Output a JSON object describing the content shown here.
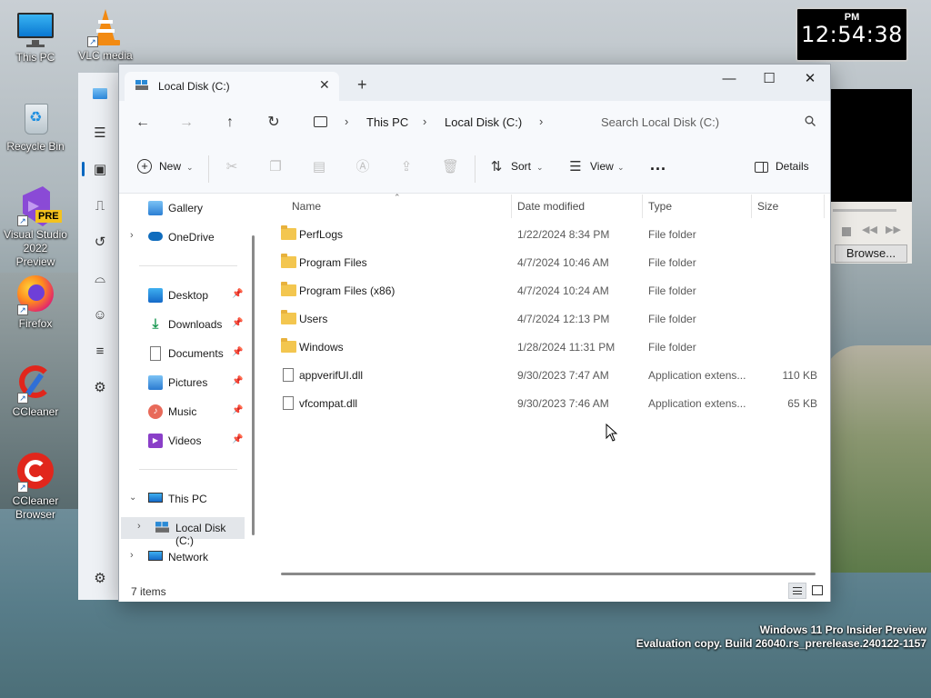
{
  "desktop": {
    "icons": [
      {
        "label": "This PC"
      },
      {
        "label": "VLC media"
      },
      {
        "label": "Recycle Bin"
      },
      {
        "label": "Visual Studio 2022 Preview"
      },
      {
        "label": "Firefox"
      },
      {
        "label": "CCleaner"
      },
      {
        "label": "CCleaner Browser"
      }
    ],
    "vs_badge": "PRE",
    "watermark_line1": "Windows 11 Pro Insider Preview",
    "watermark_line2": "Evaluation copy. Build 26040.rs_prerelease.240122-1157"
  },
  "clock": {
    "ampm": "PM",
    "time": "12:54:38"
  },
  "vlc": {
    "browse_label": "Browse..."
  },
  "explorer": {
    "tab_title": "Local Disk (C:)",
    "breadcrumb": [
      "This PC",
      "Local Disk (C:)"
    ],
    "search_placeholder": "Search Local Disk (C:)",
    "toolbar": {
      "new": "New",
      "sort": "Sort",
      "view": "View",
      "more": "...",
      "details": "Details"
    },
    "nav": {
      "gallery": "Gallery",
      "onedrive": "OneDrive",
      "desktop": "Desktop",
      "downloads": "Downloads",
      "documents": "Documents",
      "pictures": "Pictures",
      "music": "Music",
      "videos": "Videos",
      "this_pc": "This PC",
      "local_disk": "Local Disk (C:)",
      "network": "Network"
    },
    "columns": {
      "name": "Name",
      "date": "Date modified",
      "type": "Type",
      "size": "Size"
    },
    "files": [
      {
        "name": "PerfLogs",
        "date": "1/22/2024 8:34 PM",
        "type": "File folder",
        "size": "",
        "kind": "folder"
      },
      {
        "name": "Program Files",
        "date": "4/7/2024 10:46 AM",
        "type": "File folder",
        "size": "",
        "kind": "folder"
      },
      {
        "name": "Program Files (x86)",
        "date": "4/7/2024 10:24 AM",
        "type": "File folder",
        "size": "",
        "kind": "folder"
      },
      {
        "name": "Users",
        "date": "4/7/2024 12:13 PM",
        "type": "File folder",
        "size": "",
        "kind": "folder"
      },
      {
        "name": "Windows",
        "date": "1/28/2024 11:31 PM",
        "type": "File folder",
        "size": "",
        "kind": "folder"
      },
      {
        "name": "appverifUI.dll",
        "date": "9/30/2023 7:47 AM",
        "type": "Application extens...",
        "size": "110 KB",
        "kind": "dll"
      },
      {
        "name": "vfcompat.dll",
        "date": "9/30/2023 7:46 AM",
        "type": "Application extens...",
        "size": "65 KB",
        "kind": "dll"
      }
    ],
    "status_count": "7 items"
  },
  "colors": {
    "folder": "#f3c64f",
    "accent": "#0067c0",
    "selection": "#e3e6ea"
  }
}
